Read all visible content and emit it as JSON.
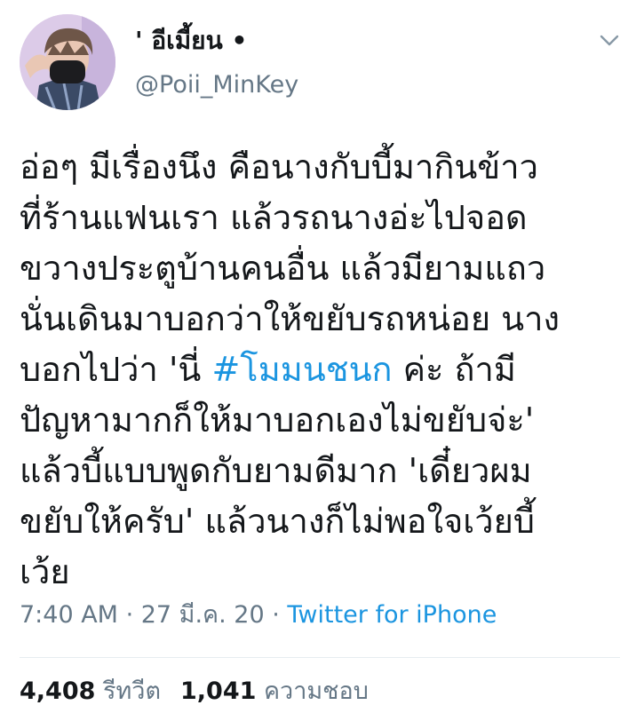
{
  "author": {
    "display_name": "' อีเมี้ยน •",
    "handle": "@Poii_MinKey"
  },
  "header": {
    "more_icon": "chevron-down-icon"
  },
  "tweet": {
    "lines": [
      "อ่อๆ มีเรื่องนึง คือนางกับบี้มากินข้าว",
      "ที่ร้านแฟนเรา แล้วรถนางอ่ะไปจอด",
      "ขวางประตูบ้านคนอื่น แล้วมียามแถว",
      "นั่นเดินมาบอกว่าให้ขยับรถหน่อย นาง"
    ],
    "line5_before": "บอกไปว่า 'นี่ ",
    "hashtag": "#โมมนชนก",
    "line5_after": " ค่ะ ถ้ามี",
    "lines_after": [
      "ปัญหามากก็ให้มาบอกเองไม่ขยับจ่ะ'",
      "แล้วบี้แบบพูดกับยามดีมาก 'เดี๋ยวผม",
      "ขยับให้ครับ' แล้วนางก็ไม่พอใจเว้ยบี้",
      "เว้ย"
    ]
  },
  "meta": {
    "time": "7:40 AM",
    "separator1": " · ",
    "date": "27 มี.ค. 20",
    "separator2": " · ",
    "source": "Twitter for iPhone"
  },
  "stats": {
    "retweets_count": "4,408",
    "retweets_label": "รีทวีต",
    "likes_count": "1,041",
    "likes_label": "ความชอบ"
  },
  "colors": {
    "link": "#1b95e0",
    "secondary": "#657786",
    "text": "#14171a",
    "divider": "#e6ecf0"
  }
}
